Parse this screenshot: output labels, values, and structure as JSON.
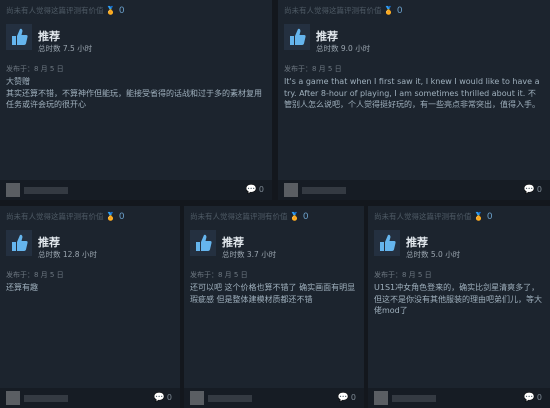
{
  "reviews": [
    {
      "helpful_text": "尚未有人觉得这篇评测有价值",
      "award_count": "0",
      "recommendation": "推荐",
      "hours": "总时数 7.5 小时",
      "posted": "发布于：8 月 5 日",
      "text": "大赞赠\n其实还算不错，不算神作但能玩，能接受省得的话战和过于多的素材复用任务或许会玩的很开心",
      "comments": "0"
    },
    {
      "helpful_text": "尚未有人觉得这篇评测有价值",
      "award_count": "0",
      "recommendation": "推荐",
      "hours": "总时数 9.0 小时",
      "posted": "发布于：8 月 5 日",
      "text": "It's a game that when I first saw it, I knew I would like to have a try. After 8-hour of playing, I am sometimes thrilled about it. 不管别人怎么说吧，个人觉得挺好玩的，有一些亮点非常突出，值得入手。",
      "comments": "0"
    },
    {
      "helpful_text": "尚未有人觉得这篇评测有价值",
      "award_count": "0",
      "recommendation": "推荐",
      "hours": "总时数 12.8 小时",
      "posted": "发布于：8 月 5 日",
      "text": "还算有趣",
      "comments": "0"
    },
    {
      "helpful_text": "尚未有人觉得这篇评测有价值",
      "award_count": "0",
      "recommendation": "推荐",
      "hours": "总时数 3.7 小时",
      "posted": "发布于：8 月 5 日",
      "text": "还可以吧 这个价格也算不错了 确实画面有明显瑕疵感 但是整体建模材质都还不错",
      "comments": "0"
    },
    {
      "helpful_text": "尚未有人觉得这篇评测有价值",
      "award_count": "0",
      "recommendation": "推荐",
      "hours": "总时数 5.0 小时",
      "posted": "发布于：8 月 5 日",
      "text": "U1S1冲女角色登来的，确实比剑星清爽多了，但这不是你没有其他服装的理由吧弟们儿，等大佬mod了",
      "comments": "0"
    }
  ],
  "icons": {
    "award": "award-icon",
    "thumb": "thumbs-up-icon",
    "comment": "comment-bubble-icon"
  },
  "colors": {
    "background": "#13171d",
    "card": "#1c242e",
    "accent": "#6a9ec8"
  }
}
